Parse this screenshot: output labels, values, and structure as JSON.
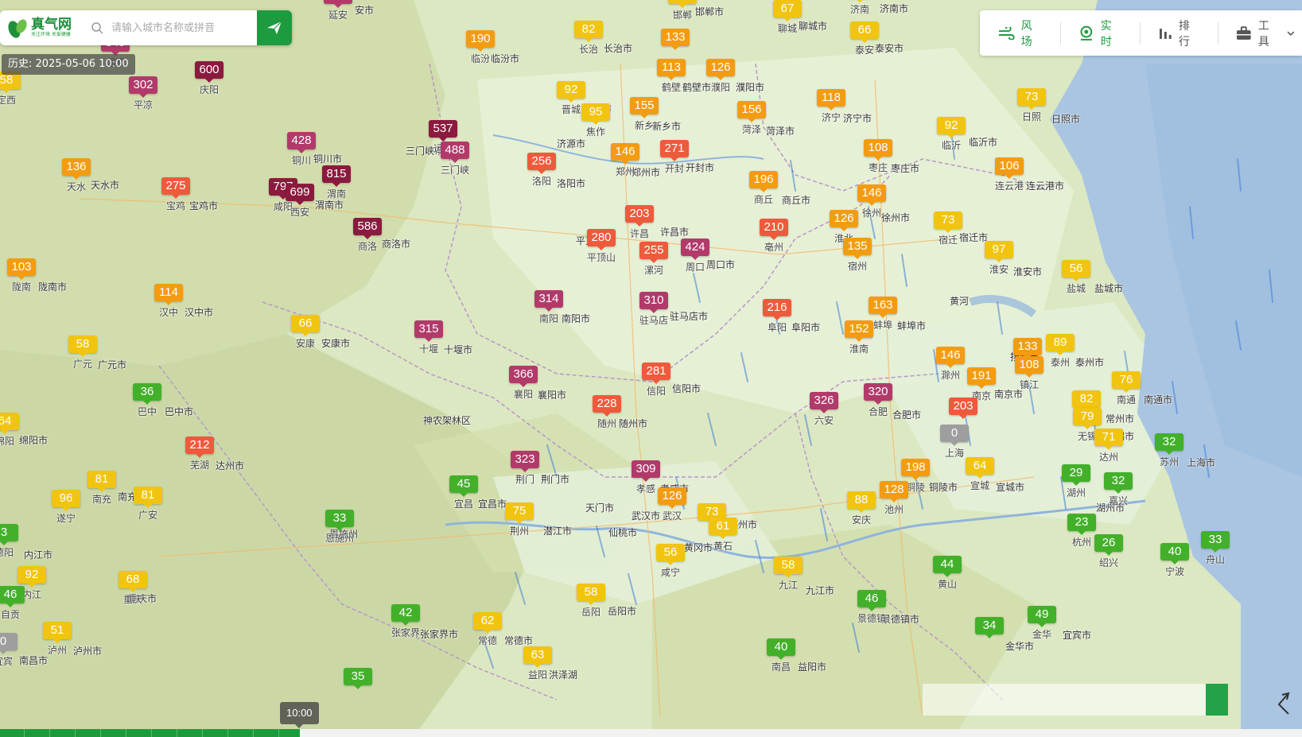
{
  "search": {
    "logo_title": "真气网",
    "logo_slogan": "关注环境 关爱健康",
    "placeholder": "请输入城市名称或拼音"
  },
  "history_label": "历史: 2025-05-06 10:00",
  "toolbar": [
    {
      "label": "风场",
      "icon": "wind-icon",
      "color": "#1e9a3f"
    },
    {
      "label": "实时",
      "icon": "realtime-location-icon",
      "color": "#1e9a3f"
    },
    {
      "label": "排行",
      "icon": "ranking-bar-icon",
      "color": "#555555"
    },
    {
      "label": "工具",
      "icon": "toolbox-icon",
      "color": "#555555"
    }
  ],
  "timeline": {
    "time_label": "10:00",
    "progress": 0.23
  },
  "colors": {
    "good": "#43b02a",
    "moderate": "#f1c40f",
    "light": "#f39c12",
    "medium": "#ee5a3c",
    "heavy": "#b23a6a",
    "severe": "#8a1a3e",
    "none": "#9e9e9e"
  },
  "stations": [
    {
      "aqi": "382",
      "city": "延安"
    },
    {
      "aqi": "84",
      "city": "邯郸"
    },
    {
      "aqi": "67",
      "city": "聊城"
    },
    {
      "aqi": "55",
      "city": "济南"
    },
    {
      "aqi": "66",
      "city": "泰安"
    },
    {
      "aqi": "349",
      "city": "固原"
    },
    {
      "aqi": "600",
      "city": "庆阳"
    },
    {
      "aqi": "302",
      "city": "平凉"
    },
    {
      "aqi": "58",
      "city": "定西"
    },
    {
      "aqi": "190",
      "city": "临汾"
    },
    {
      "aqi": "82",
      "city": "长治"
    },
    {
      "aqi": "133",
      "city": ""
    },
    {
      "aqi": "113",
      "city": "鹤壁"
    },
    {
      "aqi": "126",
      "city": "濮阳"
    },
    {
      "aqi": "118",
      "city": "济宁"
    },
    {
      "aqi": "73",
      "city": "日照"
    },
    {
      "aqi": "92",
      "city": "晋城"
    },
    {
      "aqi": "95",
      "city": "焦作"
    },
    {
      "aqi": "155",
      "city": "新乡"
    },
    {
      "aqi": "156",
      "city": "菏泽"
    },
    {
      "aqi": "92",
      "city": "临沂"
    },
    {
      "aqi": "537",
      "city": "运城"
    },
    {
      "aqi": "488",
      "city": "三门峡"
    },
    {
      "aqi": "428",
      "city": "铜川"
    },
    {
      "aqi": "815",
      "city": "渭南"
    },
    {
      "aqi": "136",
      "city": "天水"
    },
    {
      "aqi": "275",
      "city": "宝鸡"
    },
    {
      "aqi": "797",
      "city": "咸阳"
    },
    {
      "aqi": "699",
      "city": "西安"
    },
    {
      "aqi": "256",
      "city": "洛阳"
    },
    {
      "aqi": "146",
      "city": "郑州"
    },
    {
      "aqi": "271",
      "city": "开封"
    },
    {
      "aqi": "108",
      "city": "枣庄"
    },
    {
      "aqi": "196",
      "city": "商丘"
    },
    {
      "aqi": "106",
      "city": "连云港"
    },
    {
      "aqi": "146",
      "city": "徐州"
    },
    {
      "aqi": "586",
      "city": "商洛"
    },
    {
      "aqi": "203",
      "city": "许昌"
    },
    {
      "aqi": "280",
      "city": "平顶山"
    },
    {
      "aqi": "255",
      "city": "漯河"
    },
    {
      "aqi": "424",
      "city": "周口"
    },
    {
      "aqi": "210",
      "city": "亳州"
    },
    {
      "aqi": "126",
      "city": "淮北"
    },
    {
      "aqi": "73",
      "city": "宿迁"
    },
    {
      "aqi": "135",
      "city": "宿州"
    },
    {
      "aqi": "97",
      "city": "淮安"
    },
    {
      "aqi": "56",
      "city": "盐城"
    },
    {
      "aqi": "103",
      "city": "陇南"
    },
    {
      "aqi": "114",
      "city": "汉中"
    },
    {
      "aqi": "314",
      "city": "南阳"
    },
    {
      "aqi": "310",
      "city": "驻马店"
    },
    {
      "aqi": "216",
      "city": "阜阳"
    },
    {
      "aqi": "163",
      "city": "蚌埠"
    },
    {
      "aqi": "66",
      "city": "安康"
    },
    {
      "aqi": "315",
      "city": "十堰"
    },
    {
      "aqi": "152",
      "city": "淮南"
    },
    {
      "aqi": "58",
      "city": "广元"
    },
    {
      "aqi": "133",
      "city": ""
    },
    {
      "aqi": "89",
      "city": "泰州"
    },
    {
      "aqi": "108",
      "city": "镇江"
    },
    {
      "aqi": "146",
      "city": "滁州"
    },
    {
      "aqi": "191",
      "city": "南京"
    },
    {
      "aqi": "366",
      "city": "襄阳"
    },
    {
      "aqi": "281",
      "city": "信阳"
    },
    {
      "aqi": "36",
      "city": "巴中"
    },
    {
      "aqi": "326",
      "city": "六安"
    },
    {
      "aqi": "320",
      "city": "合肥"
    },
    {
      "aqi": "76",
      "city": "南通"
    },
    {
      "aqi": "228",
      "city": "随州"
    },
    {
      "aqi": "203",
      "city": ""
    },
    {
      "aqi": "82",
      "city": "常州"
    },
    {
      "aqi": "79",
      "city": "无锡"
    },
    {
      "aqi": "64",
      "city": "绵阳"
    },
    {
      "aqi": "212",
      "city": "芜湖"
    },
    {
      "aqi": "0",
      "city": "上海"
    },
    {
      "aqi": "32",
      "city": "苏州"
    },
    {
      "aqi": "71",
      "city": "达州"
    },
    {
      "aqi": "323",
      "city": "荆门"
    },
    {
      "aqi": "309",
      "city": "孝感"
    },
    {
      "aqi": "198",
      "city": "铜陵"
    },
    {
      "aqi": "64",
      "city": "宣城"
    },
    {
      "aqi": "81",
      "city": "南充"
    },
    {
      "aqi": "45",
      "city": "宜昌"
    },
    {
      "aqi": "29",
      "city": "湖州"
    },
    {
      "aqi": "32",
      "city": "嘉兴"
    },
    {
      "aqi": "96",
      "city": "遂宁"
    },
    {
      "aqi": "81",
      "city": "广安"
    },
    {
      "aqi": "126",
      "city": "武汉"
    },
    {
      "aqi": "128",
      "city": "池州"
    },
    {
      "aqi": "88",
      "city": "安庆"
    },
    {
      "aqi": "33",
      "city": "恩施州"
    },
    {
      "aqi": "75",
      "city": "荆州"
    },
    {
      "aqi": "73",
      "city": ""
    },
    {
      "aqi": "61",
      "city": "黄石"
    },
    {
      "aqi": "23",
      "city": "杭州"
    },
    {
      "aqi": "26",
      "city": "绍兴"
    },
    {
      "aqi": "33",
      "city": "舟山"
    },
    {
      "aqi": "3",
      "city": "德阳"
    },
    {
      "aqi": "40",
      "city": "宁波"
    },
    {
      "aqi": "56",
      "city": "咸宁"
    },
    {
      "aqi": "58",
      "city": "九江"
    },
    {
      "aqi": "44",
      "city": "黄山"
    },
    {
      "aqi": "92",
      "city": "内江"
    },
    {
      "aqi": "68",
      "city": "重庆"
    },
    {
      "aqi": "46",
      "city": "自贡"
    },
    {
      "aqi": "58",
      "city": "岳阳"
    },
    {
      "aqi": "46",
      "city": "景德镇"
    },
    {
      "aqi": "42",
      "city": "张家界"
    },
    {
      "aqi": "62",
      "city": "常德"
    },
    {
      "aqi": "51",
      "city": "泸州"
    },
    {
      "aqi": "34",
      "city": ""
    },
    {
      "aqi": "49",
      "city": "金华"
    },
    {
      "aqi": "0",
      "city": "宜宾"
    },
    {
      "aqi": "40",
      "city": "南昌"
    },
    {
      "aqi": "63",
      "city": "益阳"
    },
    {
      "aqi": "35",
      "city": ""
    }
  ],
  "map_labels": [
    "安市",
    "济南市",
    "邯郸市",
    "聊城市",
    "泰安市",
    "临汾市",
    "长治市",
    "鹤壁市",
    "濮阳市",
    "济宁市",
    "日照市",
    "晋城市",
    "济源市",
    "新乡市",
    "菏泽市",
    "临沂市",
    "三门峡市",
    "铜川市",
    "天水市",
    "宝鸡市",
    "渭南市",
    "洛阳市",
    "郑州市",
    "开封市",
    "枣庄市",
    "商丘市",
    "连云港市",
    "徐州市",
    "商洛市",
    "平顶山市",
    "许昌市",
    "周口市",
    "淮安市",
    "宿迁市",
    "盐城市",
    "陇南市",
    "汉中市",
    "南阳市",
    "驻马店市",
    "阜阳市",
    "蚌埠市",
    "安康市",
    "十堰市",
    "神农架林区",
    "广元市",
    "扬州市",
    "泰州市",
    "南京市",
    "襄阳市",
    "信阳市",
    "巴中市",
    "合肥市",
    "南通市",
    "随州市",
    "常州市",
    "无锡市",
    "绵阳市",
    "上海市",
    "达州市",
    "荆门市",
    "天门市",
    "孝感市",
    "铜陵市",
    "宣城市",
    "南充市",
    "宜昌市",
    "湖州市",
    "潜江市",
    "仙桃市",
    "武汉市",
    "黄冈市",
    "鄂州市",
    "杭州市",
    "恩施州",
    "九江市",
    "景德镇市",
    "内江市",
    "重庆市",
    "岳阳市",
    "张家界市",
    "常德市",
    "泸州市",
    "金华市",
    "宜宾市",
    "南昌市",
    "益阳市",
    "洪泽湖",
    "黄河"
  ]
}
